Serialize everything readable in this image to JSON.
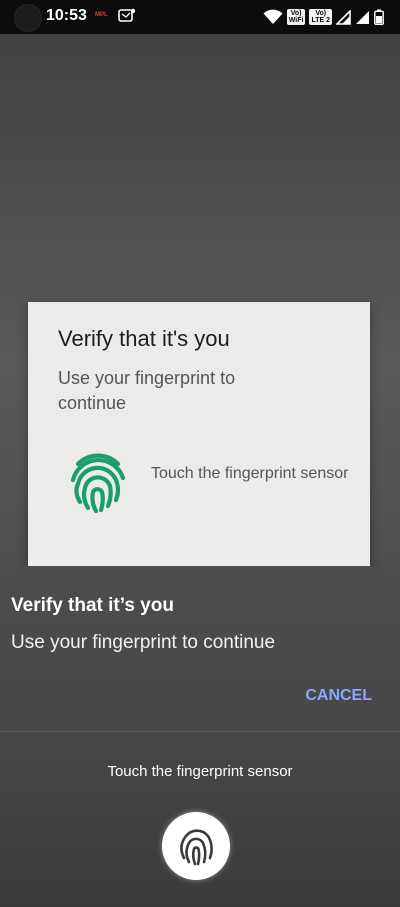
{
  "status_bar": {
    "time": "10:53",
    "notification_1": "MPL",
    "volte_wifi": [
      "Vo)",
      "WiFi"
    ],
    "volte_lte": [
      "Vo)",
      "LTE 2"
    ]
  },
  "app_dialog": {
    "title": "Verify that it's you",
    "subtitle": "Use your fingerprint to continue",
    "touch_text": "Touch the fingerprint sensor",
    "icon_color": "#1a9e6a"
  },
  "system_sheet": {
    "title": "Verify that it’s you",
    "subtitle": "Use your fingerprint to continue",
    "cancel_label": "CANCEL",
    "touch_text": "Touch the fingerprint sensor",
    "accent_color": "#8ea6ff"
  }
}
